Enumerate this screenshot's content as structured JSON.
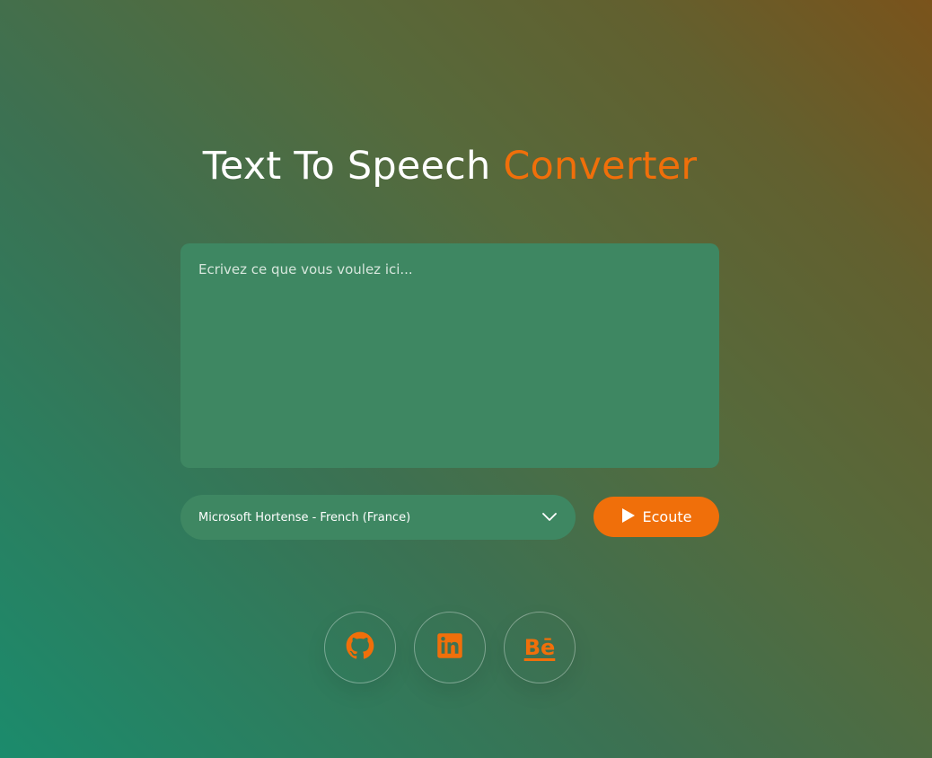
{
  "header": {
    "title_main": "Text To Speech",
    "title_accent": "Converter"
  },
  "input": {
    "placeholder": "Ecrivez ce que vous voulez ici...",
    "value": ""
  },
  "voice": {
    "selected": "Microsoft Hortense - French (France)",
    "icon": "chevron-down-icon"
  },
  "listen_button": {
    "label": "Ecoute",
    "icon": "play-icon"
  },
  "social": {
    "icons": [
      "github-icon",
      "linkedin-icon",
      "behance-icon"
    ],
    "behance_label": "Bē"
  },
  "colors": {
    "accent": "#f06f0a",
    "panel": "#3e8762",
    "text": "#ffffff"
  }
}
